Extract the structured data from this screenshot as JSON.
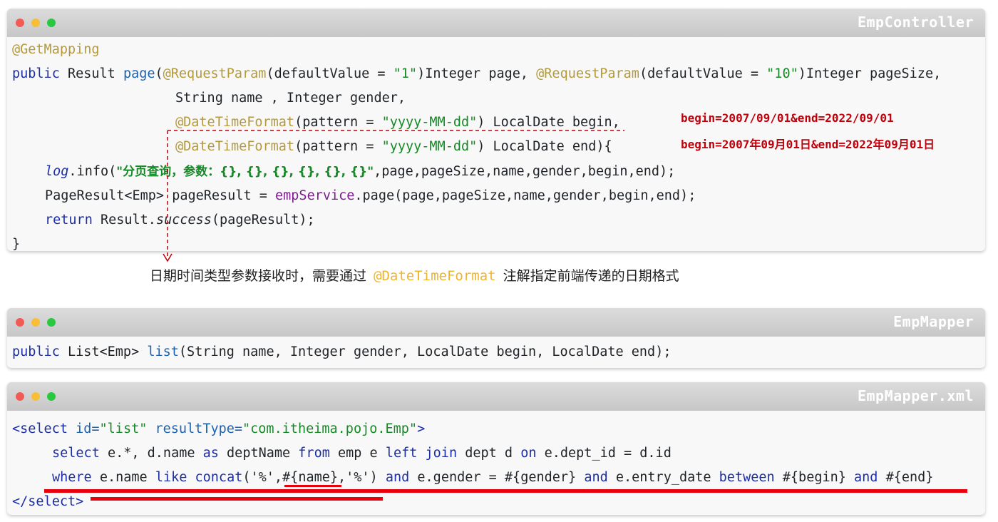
{
  "panels": {
    "controller": {
      "title": "EmpController",
      "l1": "@GetMapping",
      "l2": {
        "kw_public": "public",
        "type_result": " Result ",
        "fn_page": "page",
        "p1": "(",
        "ann1": "@RequestParam",
        "p2": "(defaultValue = ",
        "s1": "\"1\"",
        "p3": ")Integer page, ",
        "ann2": "@RequestParam",
        "p4": "(defaultValue = ",
        "s2": "\"10\"",
        "p5": ")Integer pageSize,"
      },
      "l3": "String name , Integer gender,",
      "l4": {
        "ann": "@DateTimeFormat",
        "p1": "(pattern = ",
        "s": "\"yyyy-MM-dd\"",
        "p2": ") LocalDate begin,"
      },
      "l5": {
        "ann": "@DateTimeFormat",
        "p1": "(pattern = ",
        "s": "\"yyyy-MM-dd\"",
        "p2": ") LocalDate end){"
      },
      "l6": {
        "log": "log",
        "p1": ".info(",
        "s_cn": "\"分页查询，参数：{}, {}, {}, {}, {}, {}\"",
        "p2": ",page,pageSize,name,gender,begin,end);"
      },
      "l7": {
        "p1": "PageResult<Emp> pageResult = ",
        "svc": "empService",
        "p2": ".page(page,pageSize,name,gender,begin,end);"
      },
      "l8": {
        "kw": "return",
        "p1": " Result.",
        "m": "success",
        "p2": "(pageResult);"
      },
      "l9": "}"
    },
    "mapper": {
      "title": "EmpMapper",
      "code": {
        "kw": "public",
        "p1": " List<Emp> ",
        "fn": "list",
        "p2": "(String name, Integer gender, LocalDate begin, LocalDate end);"
      }
    },
    "xml": {
      "title": "EmpMapper.xml",
      "l1": {
        "tag_open": "<select",
        "a1": " id=",
        "v1": "\"list\"",
        "a2": " resultType=",
        "v2": "\"com.itheima.pojo.Emp\"",
        "close": ">"
      },
      "l2": {
        "kw_select": "select",
        "p1": " e.*, d.name ",
        "kw_as": "as",
        "p2": " deptName ",
        "kw_from": "from",
        "p3": " emp e ",
        "kw_left": "left",
        "kw_join": "join",
        "p4": " dept d ",
        "kw_on": "on",
        "p5": " e.dept_id = d.id"
      },
      "l3": {
        "kw_where": "where",
        "p1": " e.name ",
        "kw_like": "like",
        "kw_concat": "concat",
        "p2": "('%',",
        "name": "#{name}",
        "p3": ",'%') ",
        "kw_and1": "and",
        "p4": " e.gender = #{gender} ",
        "kw_and2": "and",
        "p5": " e.entry_date ",
        "kw_between": "between",
        "p6": " #{begin} ",
        "kw_and3": "and",
        "p7": " #{end}"
      },
      "l4": {
        "tag_close": "</select",
        "close": ">"
      }
    }
  },
  "notes": {
    "begin_end_1": "begin=2007/09/01&end=2022/09/01",
    "begin_end_2": "begin=2007年09月01日&end=2022年09月01日"
  },
  "caption": {
    "before": "日期时间类型参数接收时，需要通过",
    "highlight": "@DateTimeFormat",
    "after": "注解指定前端传递的日期格式"
  },
  "colors": {
    "annotation": "#b59a3a",
    "keyword": "#1c2fa8",
    "string": "#158a26",
    "highlight_red": "#e8000c",
    "caption_highlight": "#f0b429"
  }
}
